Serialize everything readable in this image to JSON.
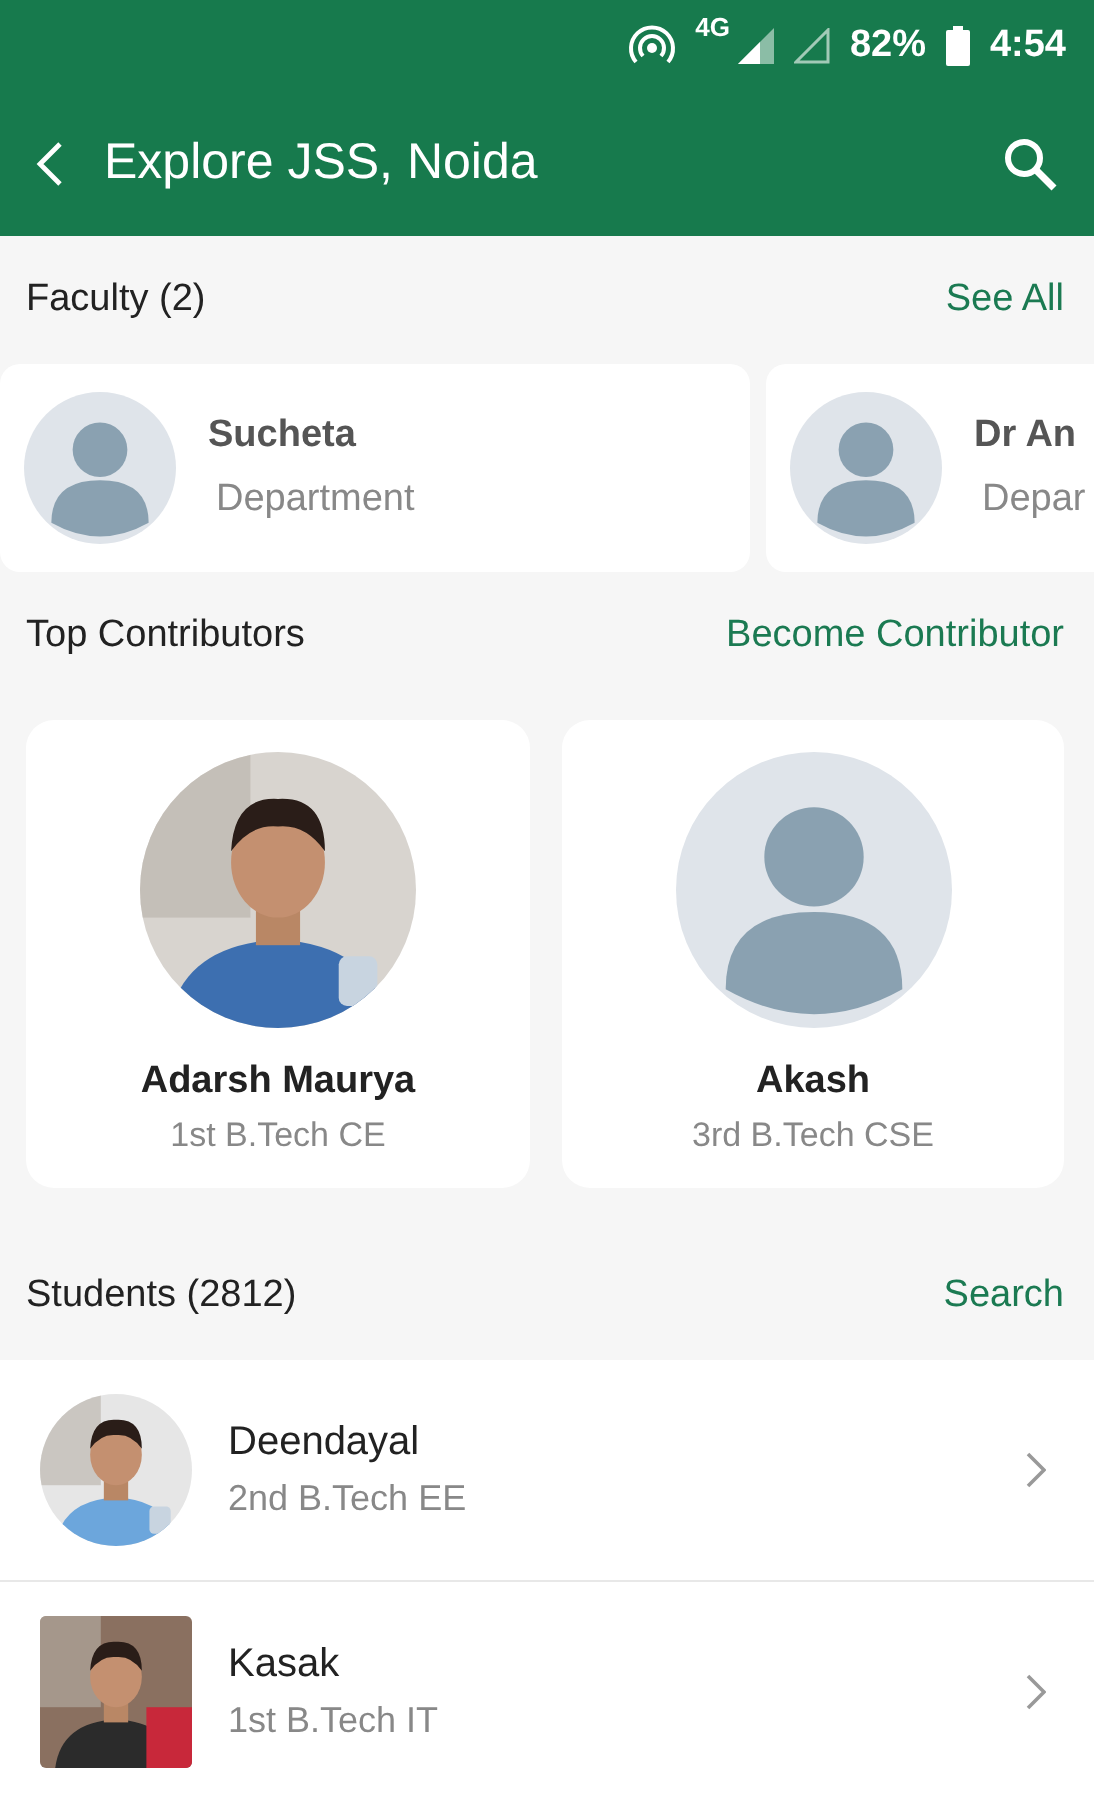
{
  "status_bar": {
    "network": "4G",
    "battery": "82%",
    "time": "4:54"
  },
  "app_bar": {
    "title": "Explore JSS, Noida"
  },
  "faculty": {
    "title": "Faculty (2)",
    "action": "See All",
    "items": [
      {
        "name": "Sucheta",
        "department": "Department"
      },
      {
        "name": "Dr An",
        "department": "Depar"
      }
    ]
  },
  "contributors": {
    "title": "Top Contributors",
    "action": "Become Contributor",
    "items": [
      {
        "name": "Adarsh Maurya",
        "course": "1st B.Tech CE"
      },
      {
        "name": "Akash",
        "course": "3rd B.Tech CSE",
        "kind": "placeholder"
      }
    ]
  },
  "students": {
    "title": "Students (2812)",
    "action": "Search",
    "items": [
      {
        "name": "Deendayal",
        "course": "2nd B.Tech EE",
        "kind": "round-photo"
      },
      {
        "name": "Kasak",
        "course": "1st B.Tech IT",
        "kind": "square-photo"
      }
    ]
  }
}
